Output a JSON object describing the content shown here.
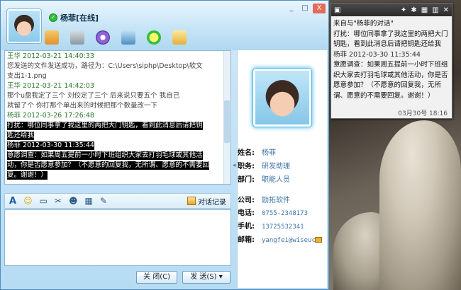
{
  "window": {
    "contact_name": "杨菲[在线]",
    "minimize": "_",
    "maximize": "□",
    "close": "X"
  },
  "toolbar_icons": [
    "transfer-icon",
    "voice-icon",
    "video-icon",
    "remote-desktop-icon",
    "multi-chat-icon",
    "mail-icon"
  ],
  "history": {
    "lines": [
      {
        "text": "王华 2012-03-21 14:40:33",
        "type": "meta"
      },
      {
        "text": "   您发送的文件发送成功，路径为：C:\\Users\\siphp\\Desktop\\软文",
        "type": "sys"
      },
      {
        "text": "支出1-1.png",
        "type": "sys"
      },
      {
        "text": "王华 2012-03-21 14:42:03",
        "type": "meta"
      },
      {
        "text": "   那个u盘我定了三个    刘佼定了三个    后来说只要五个   我自己",
        "type": "sys"
      },
      {
        "text": "就留了个      你打那个单出来的时候把那个数量改一下",
        "type": "sys"
      },
      {
        "text": "杨菲 2012-03-26 17:26:48",
        "type": "meta"
      },
      {
        "text": "   打扰：哪位同事拿了我这里的两把大门钥匙，看到此消息后请把钥",
        "type": "sel"
      },
      {
        "text": "匙还给我",
        "type": "sel"
      },
      {
        "text": "杨菲 2012-03-30 11:35:44",
        "type": "sel"
      },
      {
        "text": "   意愿调查：如果周五提前一小时下班组织大家去打羽毛球或其他活",
        "type": "sel"
      },
      {
        "text": "动，你是否愿意参加？（不愿意的回复我，无所谓、愿意的不需要回",
        "type": "sel"
      },
      {
        "text": "复。谢谢！）",
        "type": "sel"
      }
    ]
  },
  "buttons": {
    "history": "对话记录",
    "close": "关 闭(C)",
    "send": "发 送(S) ▾"
  },
  "profile": {
    "name_label": "姓名:",
    "name": "杨菲",
    "title_label": "职务:",
    "title": "研发助理",
    "dept_label": "部门:",
    "dept": "职能人员",
    "company_label": "公司:",
    "company": "励拓软件",
    "phone_label": "电话:",
    "phone": "0755-2348173",
    "mobile_label": "手机:",
    "mobile": "13725532341",
    "email_label": "邮箱:",
    "email": "yangfei@wiseuc"
  },
  "note": {
    "lines": [
      {
        "text": "来自与\"杨菲的对话\"",
        "type": "text"
      },
      {
        "text": "打扰：哪位同事拿了我这里的两把大门",
        "type": "text"
      },
      {
        "text": "钥匙，看到此消息后请把钥匙还给我",
        "type": "text"
      },
      {
        "text": "杨菲 2012-03-30 11:35:44",
        "type": "meta"
      },
      {
        "text": "意愿调查：如果周五提前一小时下班组",
        "type": "text"
      },
      {
        "text": "织大家去打羽毛球或其他活动，你是否",
        "type": "text"
      },
      {
        "text": "愿意参加？（不愿意的回复我，无所",
        "type": "text"
      },
      {
        "text": "谓、愿意的不需要回复。谢谢！）",
        "type": "text"
      }
    ],
    "date": "03月30号 18:16"
  }
}
